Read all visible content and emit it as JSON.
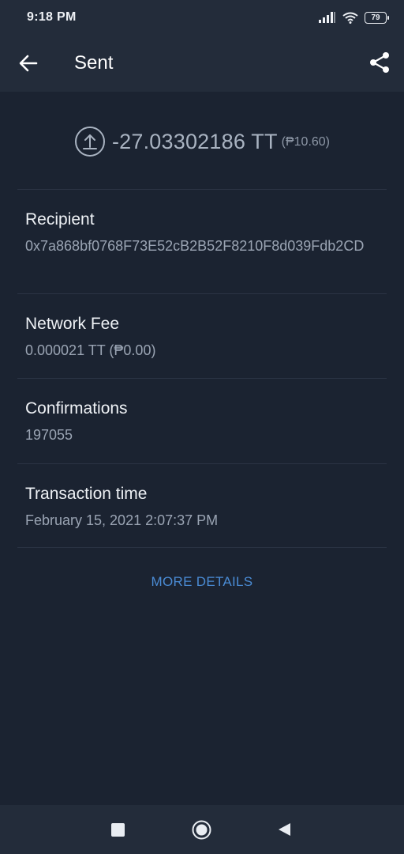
{
  "status_bar": {
    "time": "9:18 PM",
    "battery": "79",
    "icons": [
      "signal-icon",
      "wifi-icon",
      "battery-icon"
    ]
  },
  "app_bar": {
    "title": "Sent",
    "back_icon": "arrow-left-icon",
    "share_icon": "share-icon"
  },
  "transaction": {
    "direction_icon": "upload-circle-icon",
    "amount": "-27.03302186 TT",
    "fiat": "(₱10.60)"
  },
  "details": [
    {
      "label": "Recipient",
      "value": "0x7a868bf0768F73E52cB2B52F8210F8d039Fdb2CD"
    },
    {
      "label": "Network Fee",
      "value": "0.000021 TT (₱0.00)"
    },
    {
      "label": "Confirmations",
      "value": "197055"
    },
    {
      "label": "Transaction time",
      "value": "February 15, 2021 2:07:37 PM"
    }
  ],
  "more_details_label": "MORE DETAILS",
  "nav_bar": {
    "icons": [
      "recents-square-icon",
      "home-circle-icon",
      "back-triangle-icon"
    ]
  },
  "colors": {
    "background": "#1b2331",
    "bar": "#232c3a",
    "accent": "#4a8bd4"
  }
}
